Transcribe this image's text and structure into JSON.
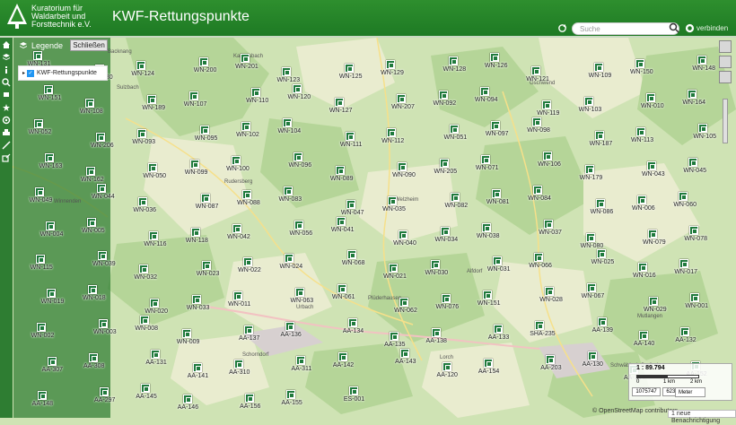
{
  "header": {
    "logo_text": "Kuratorium für Waldarbeit und Forsttechnik e.V.",
    "title": "KWF-Rettungspunkte",
    "search_placeholder": "Suche",
    "link_label": "verbinden"
  },
  "legend": {
    "title": "Legende",
    "close_label": "Schließen",
    "layer_label": "KWF-Rettungspunkte"
  },
  "scale": {
    "ratio": "1 : 89.794",
    "ticks": [
      "0",
      "1 km",
      "2 km"
    ],
    "x": "1075747",
    "y": "6236063",
    "unit": "Meter"
  },
  "attribution": "© OpenStreetMap contributors",
  "notification": "1 neue Benachrichtigung",
  "places": [
    "Backnang",
    "Sulzbach",
    "Welzheim",
    "Winnenden",
    "Schorndorf",
    "Lorch",
    "Schwäbisch Gmünd",
    "Mutlangen",
    "Urbach",
    "Plüderhausen",
    "Kaisersbach",
    "Gschwend",
    "Alfdorf",
    "Rudersberg"
  ],
  "rescue_points": [
    "WN-131",
    "WN-130",
    "WN-124",
    "WN-200",
    "WN-201",
    "WN-123",
    "WN-125",
    "WN-129",
    "WN-128",
    "WN-126",
    "WN-121",
    "WN-109",
    "WN-150",
    "WN-148",
    "WN-151",
    "WN-108",
    "WN-189",
    "WN-107",
    "WN-110",
    "WN-120",
    "WN-127",
    "WN-207",
    "WN-092",
    "WN-094",
    "WN-119",
    "WN-103",
    "WN-010",
    "WN-164",
    "WN-052",
    "WN-206",
    "WN-093",
    "WN-095",
    "WN-102",
    "WN-104",
    "WN-111",
    "WN-112",
    "WN-051",
    "WN-097",
    "WN-098",
    "WN-187",
    "WN-113",
    "WN-105",
    "WN-163",
    "WN-162",
    "WN-050",
    "WN-099",
    "WN-100",
    "WN-096",
    "WN-089",
    "WN-090",
    "WN-205",
    "WN-071",
    "WN-106",
    "WN-179",
    "WN-043",
    "WN-045",
    "WN-049",
    "WN-044",
    "WN-036",
    "WN-087",
    "WN-088",
    "WN-083",
    "WN-047",
    "WN-035",
    "WN-082",
    "WN-081",
    "WN-084",
    "WN-086",
    "WN-006",
    "WN-060",
    "WN-004",
    "WN-005",
    "WN-116",
    "WN-118",
    "WN-042",
    "WN-056",
    "WN-041",
    "WN-040",
    "WN-034",
    "WN-038",
    "WN-037",
    "WN-080",
    "WN-079",
    "WN-078",
    "WN-115",
    "WN-039",
    "WN-032",
    "WN-023",
    "WN-022",
    "WN-024",
    "WN-068",
    "WN-021",
    "WN-030",
    "WN-031",
    "WN-066",
    "WN-025",
    "WN-016",
    "WN-017",
    "WN-019",
    "WN-018",
    "WN-020",
    "WN-033",
    "WN-011",
    "WN-063",
    "WN-061",
    "WN-062",
    "WN-076",
    "WN-151",
    "WN-028",
    "WN-067",
    "WN-029",
    "WN-001",
    "WN-002",
    "WN-003",
    "WN-008",
    "WN-009",
    "AA-137",
    "AA-136",
    "AA-134",
    "AA-135",
    "AA-138",
    "AA-133",
    "SHA-235",
    "AA-139",
    "AA-140",
    "AA-132",
    "AA-307",
    "AA-308",
    "AA-131",
    "AA-141",
    "AA-310",
    "AA-311",
    "AA-142",
    "AA-143",
    "AA-120",
    "AA-154",
    "AA-203",
    "AA-130",
    "AA-144",
    "AA-152",
    "AA-148",
    "AA-297",
    "AA-145",
    "AA-146",
    "AA-156",
    "AA-155",
    "ES-001"
  ],
  "colors": {
    "header": "#1e7a24",
    "marker": "#1f7a3c",
    "forest": "#b5d598",
    "field": "#e9eccf"
  }
}
